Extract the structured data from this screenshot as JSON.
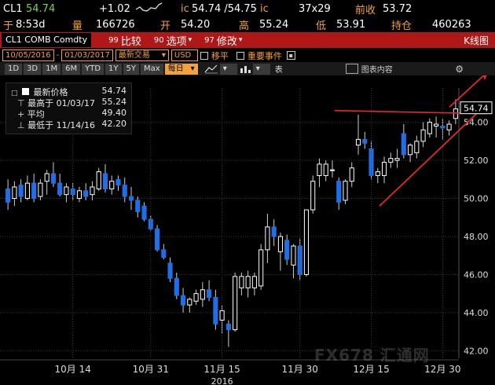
{
  "quote": {
    "ticker": "CL1",
    "last": "54.74",
    "change": "+1.02",
    "bid_label": "ic",
    "bid_ask": "54.74 /54.75",
    "ask_label": "ic",
    "size": "37x29",
    "prev_close_label": "前收",
    "prev_close": "53.72",
    "time_prefix": "于",
    "time": "8:53d",
    "volume_label": "量",
    "volume": "166726",
    "open_label": "开",
    "open": "54.20",
    "high_label": "高",
    "high": "55.24",
    "low_label": "低",
    "low": "53.91",
    "oi_label": "持仓",
    "oi": "460263"
  },
  "titlebar": {
    "security": "CL1 COMB Comdty",
    "tabs": [
      {
        "num": "99",
        "label": "比较"
      },
      {
        "num": "90",
        "label": "选项"
      },
      {
        "num": "97",
        "label": "修改"
      }
    ],
    "right_label": "K线图"
  },
  "toolbar": {
    "start_date": "10/05/2016",
    "end_date": "01/03/2017",
    "mode": "最新交易",
    "currency": "USD",
    "move_avg": "移平",
    "events": "重要事件"
  },
  "periods": {
    "items": [
      "1D",
      "3D",
      "1M",
      "6M",
      "YTD",
      "1Y",
      "5Y",
      "Max"
    ],
    "interval": "每日",
    "chart_type": "表",
    "chart_content": "图表内容"
  },
  "drawbar": {
    "items": [
      "追踪",
      "注释",
      "新闻",
      "缩放"
    ]
  },
  "legend": {
    "rows": [
      {
        "label": "最新价格",
        "value": "54.74"
      },
      {
        "label": "最高于 01/03/17",
        "value": "55.24"
      },
      {
        "label": "平均",
        "value": "49.40"
      },
      {
        "label": "最低于 11/14/16",
        "value": "42.20"
      }
    ]
  },
  "chart_data": {
    "type": "candlestick",
    "y_ticks": [
      "54.00",
      "52.00",
      "50.00",
      "48.00",
      "46.00",
      "44.00",
      "42.00"
    ],
    "x_ticks": [
      "10月 14",
      "10月 31",
      "11月 15",
      "11月 30",
      "12月 15",
      "12月 30"
    ],
    "x_sublabel": "2016",
    "last_price_label": "54.74",
    "ylim": [
      41.6,
      55.8
    ],
    "colors": {
      "up": "#ffffff",
      "down": "#1f6fe6",
      "trend": "#e22a2a",
      "grid": "#3c3c3c"
    },
    "candles": [
      {
        "o": 50.5,
        "h": 51.0,
        "l": 49.4,
        "c": 49.8
      },
      {
        "o": 50.0,
        "h": 50.9,
        "l": 49.6,
        "c": 50.6
      },
      {
        "o": 50.7,
        "h": 51.0,
        "l": 49.8,
        "c": 50.1
      },
      {
        "o": 50.0,
        "h": 51.2,
        "l": 49.9,
        "c": 50.8
      },
      {
        "o": 50.8,
        "h": 51.3,
        "l": 49.8,
        "c": 50.0
      },
      {
        "o": 50.1,
        "h": 51.0,
        "l": 49.9,
        "c": 50.8
      },
      {
        "o": 50.9,
        "h": 51.5,
        "l": 50.2,
        "c": 51.3
      },
      {
        "o": 51.3,
        "h": 51.9,
        "l": 50.6,
        "c": 50.8
      },
      {
        "o": 50.8,
        "h": 51.3,
        "l": 50.1,
        "c": 50.2
      },
      {
        "o": 50.2,
        "h": 50.8,
        "l": 49.8,
        "c": 50.6
      },
      {
        "o": 50.5,
        "h": 50.8,
        "l": 49.9,
        "c": 50.2
      },
      {
        "o": 50.0,
        "h": 50.6,
        "l": 49.8,
        "c": 50.4
      },
      {
        "o": 50.4,
        "h": 50.8,
        "l": 49.9,
        "c": 50.1
      },
      {
        "o": 50.2,
        "h": 50.9,
        "l": 49.9,
        "c": 50.6
      },
      {
        "o": 50.5,
        "h": 51.6,
        "l": 50.4,
        "c": 51.4
      },
      {
        "o": 51.3,
        "h": 51.8,
        "l": 50.3,
        "c": 50.5
      },
      {
        "o": 50.5,
        "h": 51.2,
        "l": 50.2,
        "c": 50.9
      },
      {
        "o": 51.0,
        "h": 51.2,
        "l": 50.4,
        "c": 50.7
      },
      {
        "o": 50.7,
        "h": 51.1,
        "l": 49.8,
        "c": 50.1
      },
      {
        "o": 50.1,
        "h": 50.6,
        "l": 49.4,
        "c": 49.9
      },
      {
        "o": 49.9,
        "h": 50.1,
        "l": 49.0,
        "c": 49.3
      },
      {
        "o": 49.6,
        "h": 49.8,
        "l": 48.8,
        "c": 48.9
      },
      {
        "o": 48.9,
        "h": 49.1,
        "l": 48.3,
        "c": 48.4
      },
      {
        "o": 48.4,
        "h": 48.6,
        "l": 47.2,
        "c": 47.3
      },
      {
        "o": 47.3,
        "h": 47.6,
        "l": 46.8,
        "c": 46.9
      },
      {
        "o": 46.6,
        "h": 46.9,
        "l": 45.6,
        "c": 45.8
      },
      {
        "o": 45.8,
        "h": 46.1,
        "l": 44.7,
        "c": 44.9
      },
      {
        "o": 44.9,
        "h": 45.3,
        "l": 44.0,
        "c": 44.4
      },
      {
        "o": 44.4,
        "h": 44.8,
        "l": 44.0,
        "c": 44.7
      },
      {
        "o": 44.6,
        "h": 45.2,
        "l": 44.4,
        "c": 45.0
      },
      {
        "o": 44.7,
        "h": 45.6,
        "l": 44.3,
        "c": 45.2
      },
      {
        "o": 45.2,
        "h": 45.7,
        "l": 44.6,
        "c": 44.8
      },
      {
        "o": 44.8,
        "h": 45.2,
        "l": 43.1,
        "c": 43.4
      },
      {
        "o": 43.6,
        "h": 44.4,
        "l": 42.9,
        "c": 44.1
      },
      {
        "o": 43.4,
        "h": 43.6,
        "l": 42.2,
        "c": 43.1
      },
      {
        "o": 43.1,
        "h": 46.1,
        "l": 43.0,
        "c": 45.9
      },
      {
        "o": 45.3,
        "h": 46.1,
        "l": 44.9,
        "c": 45.9
      },
      {
        "o": 45.3,
        "h": 46.2,
        "l": 44.8,
        "c": 45.9
      },
      {
        "o": 45.3,
        "h": 46.1,
        "l": 44.9,
        "c": 45.9
      },
      {
        "o": 45.4,
        "h": 47.6,
        "l": 45.2,
        "c": 47.3
      },
      {
        "o": 47.3,
        "h": 49.2,
        "l": 46.6,
        "c": 48.5
      },
      {
        "o": 48.5,
        "h": 48.9,
        "l": 47.5,
        "c": 48.0
      },
      {
        "o": 47.2,
        "h": 48.2,
        "l": 46.2,
        "c": 48.0
      },
      {
        "o": 47.8,
        "h": 48.1,
        "l": 46.5,
        "c": 46.8
      },
      {
        "o": 46.5,
        "h": 47.6,
        "l": 45.8,
        "c": 47.5
      },
      {
        "o": 47.5,
        "h": 47.9,
        "l": 45.7,
        "c": 46.0
      },
      {
        "o": 46.0,
        "h": 49.4,
        "l": 45.9,
        "c": 49.4
      },
      {
        "o": 49.4,
        "h": 51.2,
        "l": 49.2,
        "c": 50.9
      },
      {
        "o": 51.2,
        "h": 52.1,
        "l": 50.6,
        "c": 51.8
      },
      {
        "o": 51.2,
        "h": 52.0,
        "l": 50.9,
        "c": 51.8
      },
      {
        "o": 51.5,
        "h": 52.0,
        "l": 51.1,
        "c": 51.5
      },
      {
        "o": 50.9,
        "h": 51.1,
        "l": 49.4,
        "c": 49.8
      },
      {
        "o": 49.9,
        "h": 51.0,
        "l": 49.7,
        "c": 50.9
      },
      {
        "o": 50.9,
        "h": 51.9,
        "l": 50.6,
        "c": 51.6
      },
      {
        "o": 52.8,
        "h": 54.4,
        "l": 52.3,
        "c": 53.1
      },
      {
        "o": 53.1,
        "h": 53.5,
        "l": 52.6,
        "c": 52.9
      },
      {
        "o": 52.6,
        "h": 53.0,
        "l": 51.0,
        "c": 51.2
      },
      {
        "o": 51.2,
        "h": 51.6,
        "l": 50.8,
        "c": 51.4
      },
      {
        "o": 51.2,
        "h": 52.2,
        "l": 50.8,
        "c": 51.9
      },
      {
        "o": 51.9,
        "h": 52.4,
        "l": 51.6,
        "c": 52.1
      },
      {
        "o": 52.0,
        "h": 52.6,
        "l": 51.6,
        "c": 52.1
      },
      {
        "o": 53.4,
        "h": 53.9,
        "l": 52.1,
        "c": 52.3
      },
      {
        "o": 52.3,
        "h": 52.9,
        "l": 51.9,
        "c": 52.8
      },
      {
        "o": 52.4,
        "h": 53.3,
        "l": 52.1,
        "c": 53.0
      },
      {
        "o": 53.0,
        "h": 54.0,
        "l": 52.7,
        "c": 53.6
      },
      {
        "o": 53.4,
        "h": 54.2,
        "l": 53.2,
        "c": 54.0
      },
      {
        "o": 53.8,
        "h": 54.3,
        "l": 53.2,
        "c": 53.9
      },
      {
        "o": 53.8,
        "h": 54.2,
        "l": 53.1,
        "c": 53.7
      },
      {
        "o": 53.6,
        "h": 54.1,
        "l": 53.3,
        "c": 53.9
      },
      {
        "o": 54.2,
        "h": 55.2,
        "l": 53.9,
        "c": 54.7
      }
    ]
  },
  "watermark": "FX678 汇通网"
}
